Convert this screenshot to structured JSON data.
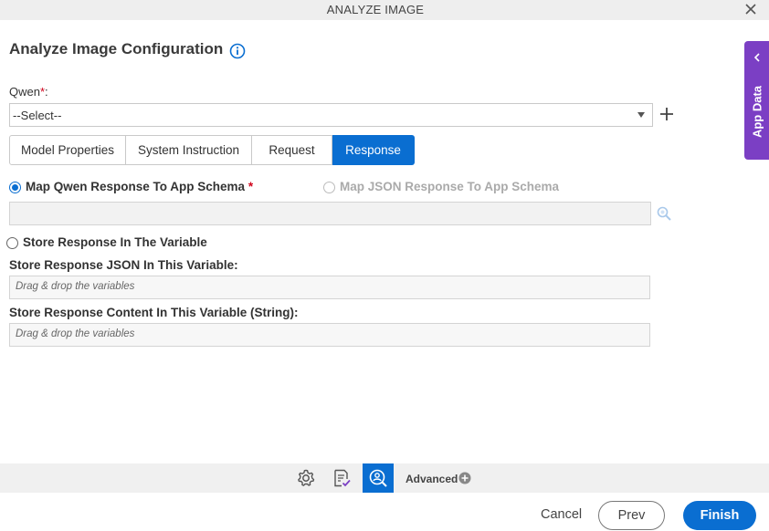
{
  "window": {
    "title": "ANALYZE IMAGE"
  },
  "page": {
    "heading": "Analyze Image Configuration"
  },
  "app_data_panel": {
    "label": "App Data"
  },
  "qwen": {
    "label": "Qwen",
    "required_mark": "*",
    "label_suffix": ":",
    "selected": "--Select--"
  },
  "tabs": [
    {
      "label": "Model Properties",
      "active": false
    },
    {
      "label": "System Instruction",
      "active": false
    },
    {
      "label": "Request",
      "active": false
    },
    {
      "label": "Response",
      "active": true
    }
  ],
  "response": {
    "map_app_schema_label": "Map Qwen Response To App Schema",
    "map_app_schema_required": "*",
    "map_json_label": "Map JSON Response To App Schema",
    "store_variable_label": "Store Response In The Variable",
    "json_variable_label": "Store Response JSON In This Variable:",
    "json_variable_placeholder": "Drag & drop the variables",
    "content_variable_label": "Store Response Content In This Variable (String):",
    "content_variable_placeholder": "Drag & drop the variables"
  },
  "toolbar": {
    "advanced_label": "Advanced"
  },
  "footer": {
    "cancel": "Cancel",
    "prev": "Prev",
    "finish": "Finish"
  },
  "colors": {
    "primary": "#0a6ed1",
    "app_data": "#7b3fc4",
    "required": "#d0021b"
  },
  "icons": [
    "close-icon",
    "info-icon",
    "chevron-left-icon",
    "chevron-down-icon",
    "plus-icon",
    "search-icon",
    "gear-icon",
    "checklist-icon",
    "image-search-icon",
    "plus-circle-icon"
  ]
}
